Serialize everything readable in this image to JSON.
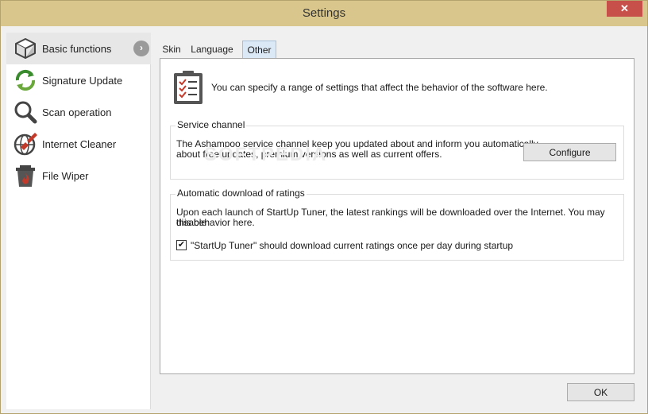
{
  "window": {
    "title": "Settings",
    "close_label": "✕"
  },
  "sidebar": {
    "items": [
      {
        "label": "Basic functions",
        "icon": "box-icon",
        "active": true
      },
      {
        "label": "Signature Update",
        "icon": "refresh-icon"
      },
      {
        "label": "Scan operation",
        "icon": "magnifier-icon"
      },
      {
        "label": "Internet Cleaner",
        "icon": "globe-broom-icon"
      },
      {
        "label": "File Wiper",
        "icon": "trash-fire-icon"
      }
    ],
    "active_arrow": "›"
  },
  "tabs": [
    {
      "label": "Skin"
    },
    {
      "label": "Language"
    },
    {
      "label": "Other",
      "active": true
    }
  ],
  "panel": {
    "intro": "You can specify a range of settings that affect the behavior of the software here.",
    "service_channel": {
      "title": "Service channel",
      "text_line1": "The Ashampoo service channel keep you updated about and inform you automatically",
      "text_line2": "about free updates, premium versions as well as current offers.",
      "button": "Configure"
    },
    "ratings": {
      "title": "Automatic download of ratings",
      "text_line1": "Upon each launch of StartUp Tuner, the latest rankings will be downloaded over the Internet. You may disable",
      "text_line2": "this behavior here.",
      "checkbox_label": "\"StartUp Tuner\" should download current ratings once per day during startup",
      "checkbox_mark": "✔",
      "checked": true
    }
  },
  "footer": {
    "ok_label": "OK"
  },
  "watermark": "SOFTPEDIA",
  "colors": {
    "titlebar": "#d8c68c",
    "close": "#c7514a",
    "icon_accent": "#c43a2a"
  }
}
